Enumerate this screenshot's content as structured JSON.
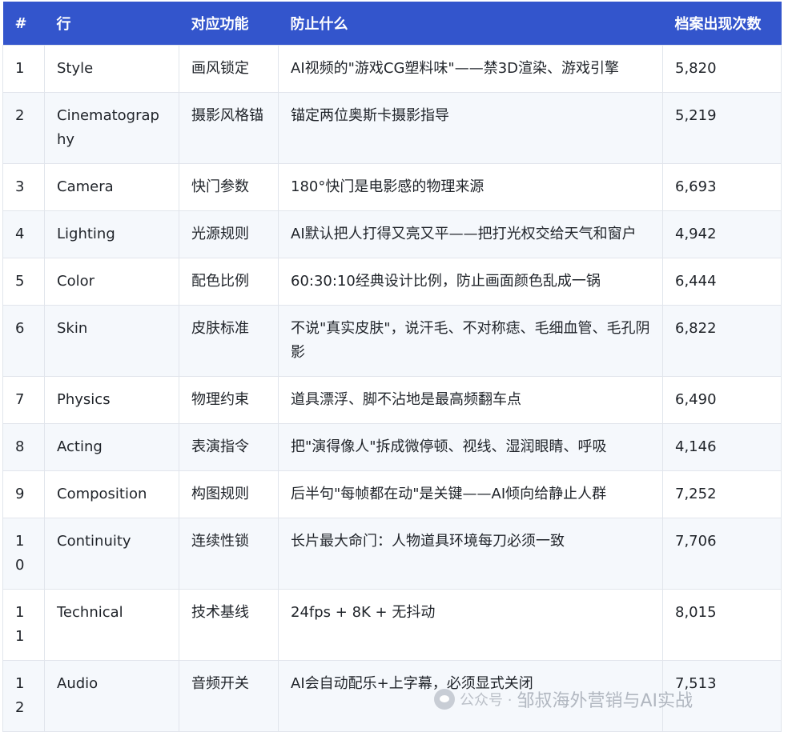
{
  "table": {
    "headers": {
      "num": "#",
      "row": "行",
      "function": "对应功能",
      "prevents": "防止什么",
      "count": "档案出现次数"
    },
    "rows": [
      {
        "num": "1",
        "row": "Style",
        "function": "画风锁定",
        "prevents": "AI视频的\"游戏CG塑料味\"——禁3D渲染、游戏引擎",
        "count": "5,820"
      },
      {
        "num": "2",
        "row": "Cinematography",
        "function": "摄影风格锚",
        "prevents": "锚定两位奥斯卡摄影指导",
        "count": "5,219"
      },
      {
        "num": "3",
        "row": "Camera",
        "function": "快门参数",
        "prevents": "180°快门是电影感的物理来源",
        "count": "6,693"
      },
      {
        "num": "4",
        "row": "Lighting",
        "function": "光源规则",
        "prevents": "AI默认把人打得又亮又平——把打光权交给天气和窗户",
        "count": "4,942"
      },
      {
        "num": "5",
        "row": "Color",
        "function": "配色比例",
        "prevents": "60:30:10经典设计比例，防止画面颜色乱成一锅",
        "count": "6,444"
      },
      {
        "num": "6",
        "row": "Skin",
        "function": "皮肤标准",
        "prevents": "不说\"真实皮肤\"，说汗毛、不对称痣、毛细血管、毛孔阴影",
        "count": "6,822"
      },
      {
        "num": "7",
        "row": "Physics",
        "function": "物理约束",
        "prevents": "道具漂浮、脚不沾地是最高频翻车点",
        "count": "6,490"
      },
      {
        "num": "8",
        "row": "Acting",
        "function": "表演指令",
        "prevents": "把\"演得像人\"拆成微停顿、视线、湿润眼睛、呼吸",
        "count": "4,146"
      },
      {
        "num": "9",
        "row": "Composition",
        "function": "构图规则",
        "prevents": "后半句\"每帧都在动\"是关键——AI倾向给静止人群",
        "count": "7,252"
      },
      {
        "num": "10",
        "row": "Continuity",
        "function": "连续性锁",
        "prevents": "长片最大命门：人物道具环境每刀必须一致",
        "count": "7,706"
      },
      {
        "num": "11",
        "row": "Technical",
        "function": "技术基线",
        "prevents": "24fps + 8K + 无抖动",
        "count": "8,015"
      },
      {
        "num": "12",
        "row": "Audio",
        "function": "音频开关",
        "prevents": "AI会自动配乐+上字幕，必须显式关闭",
        "count": "7,513"
      }
    ]
  },
  "watermark": {
    "prefix": "公众号 ·",
    "text": "邹叔海外营销与AI实战"
  }
}
